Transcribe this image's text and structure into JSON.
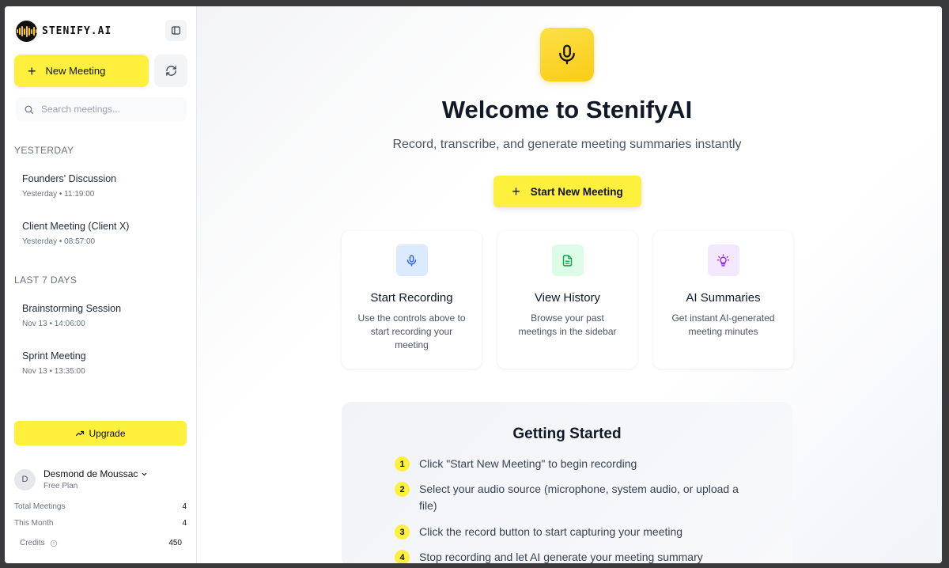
{
  "sidebar": {
    "brand": "STENIFY.AI",
    "new_meeting_label": "New Meeting",
    "search_placeholder": "Search meetings...",
    "groups": [
      {
        "label": "YESTERDAY",
        "items": [
          {
            "title": "Founders' Discussion",
            "time": "Yesterday • 11:19:00"
          },
          {
            "title": "Client Meeting (Client X)",
            "time": "Yesterday • 08:57:00"
          }
        ]
      },
      {
        "label": "LAST 7 DAYS",
        "items": [
          {
            "title": "Brainstorming Session",
            "time": "Nov 13 • 14:06:00"
          },
          {
            "title": "Sprint Meeting",
            "time": "Nov 13 • 13:35:00"
          }
        ]
      }
    ],
    "upgrade_label": "Upgrade",
    "user": {
      "initial": "D",
      "name": "Desmond de Moussac",
      "plan": "Free Plan"
    },
    "stats": [
      {
        "label": "Total Meetings",
        "value": "4"
      },
      {
        "label": "This Month",
        "value": "4"
      },
      {
        "label": "Credits",
        "value": "450"
      }
    ]
  },
  "main": {
    "title": "Welcome to StenifyAI",
    "subtitle": "Record, transcribe, and generate meeting summaries instantly",
    "start_label": "Start New Meeting",
    "cards": [
      {
        "title": "Start Recording",
        "desc": "Use the controls above to start recording your meeting",
        "icon": "microphone-icon",
        "bg": "#dbeafe",
        "color": "#2563eb"
      },
      {
        "title": "View History",
        "desc": "Browse your past meetings in the sidebar",
        "icon": "document-icon",
        "bg": "#dcfce7",
        "color": "#16a34a"
      },
      {
        "title": "AI Summaries",
        "desc": "Get instant AI-generated meeting minutes",
        "icon": "lightbulb-icon",
        "bg": "#f3e8ff",
        "color": "#9333ea"
      }
    ],
    "getting_started": {
      "title": "Getting Started",
      "steps": [
        {
          "num": "1",
          "text": "Click \"Start New Meeting\" to begin recording"
        },
        {
          "num": "2",
          "text": "Select your audio source (microphone, system audio, or upload a file)"
        },
        {
          "num": "3",
          "text": "Click the record button to start capturing your meeting"
        },
        {
          "num": "4",
          "text": "Stop recording and let AI generate your meeting summary"
        }
      ]
    }
  },
  "colors": {
    "accent": "#fef03c",
    "accent_dark": "#facc15",
    "text": "#111827",
    "muted": "#6b7280"
  }
}
